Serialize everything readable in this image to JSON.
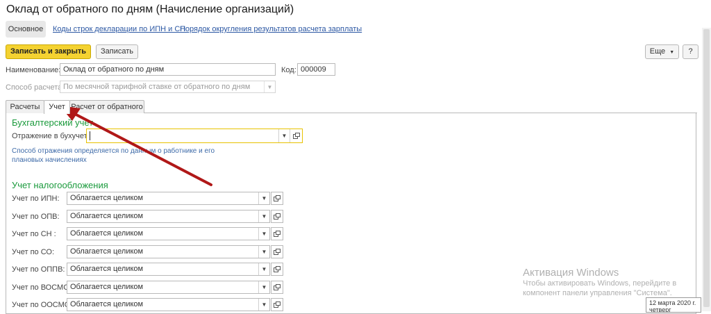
{
  "window": {
    "title": "Оклад от обратного по дням (Начисление организаций)"
  },
  "nav": {
    "active_tab": "Основное",
    "links": [
      "Коды строк декларации по ИПН и СН",
      "Порядок округления результатов расчета зарплаты"
    ]
  },
  "toolbar": {
    "save_close_label": "Записать и закрыть",
    "save_label": "Записать",
    "more_label": "Еще",
    "help_label": "?"
  },
  "form": {
    "name_label": "Наименование:",
    "name_value": "Оклад от обратного по дням",
    "code_label": "Код:",
    "code_value": "000009",
    "calc_method_label": "Способ расчета:",
    "calc_method_value": "По месячной тарифной ставке от обратного по дням"
  },
  "tabs": [
    "Расчеты",
    "Учет",
    "Расчет от обратного"
  ],
  "accounting": {
    "section_title": "Бухгалтерский учет",
    "reflection_label": "Отражение в бухучете:",
    "reflection_value": "",
    "hint": "Способ отражения определяется по данным о работнике и его плановых начислениях"
  },
  "tax": {
    "section_title": "Учет налогообложения",
    "rows": [
      {
        "label": "Учет по ИПН:",
        "value": "Облагается целиком"
      },
      {
        "label": "Учет по ОПВ:",
        "value": "Облагается целиком"
      },
      {
        "label": "Учет по СН :",
        "value": "Облагается целиком"
      },
      {
        "label": "Учет по СО:",
        "value": "Облагается целиком"
      },
      {
        "label": "Учет по ОППВ:",
        "value": "Облагается целиком"
      },
      {
        "label": "Учет по ВОСМС:",
        "value": "Облагается целиком"
      },
      {
        "label": "Учет по ООСМС:",
        "value": "Облагается целиком"
      }
    ]
  },
  "watermark": {
    "line1": "Активация Windows",
    "line2": "Чтобы активировать Windows, перейдите в",
    "line3": "компонент панели управления \"Система\"."
  },
  "taskbar": {
    "date": "12 марта 2020 г.",
    "day": "четверг"
  },
  "colors": {
    "accent_button": "#f4d231",
    "section_title": "#1a9a3c",
    "link": "#2b57a3",
    "annotation_arrow": "#b01818",
    "focus_border": "#e8c200"
  }
}
